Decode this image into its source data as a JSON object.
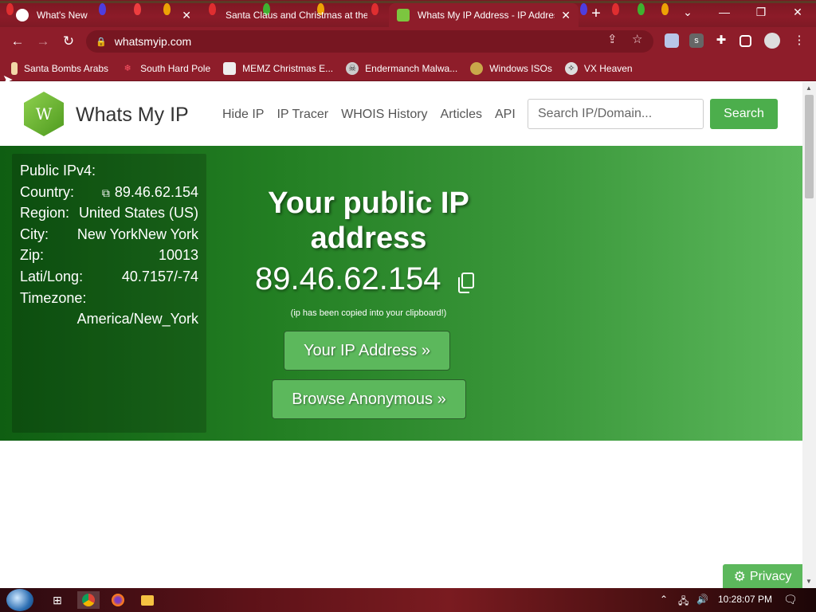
{
  "browser": {
    "tabs": [
      {
        "title": "What's New",
        "active": false
      },
      {
        "title": "Santa Claus and Christmas at the",
        "active": false
      },
      {
        "title": "Whats My IP Address - IP Addres",
        "active": true
      }
    ],
    "close_glyph": "✕",
    "new_tab_glyph": "+",
    "url": "whatsmyip.com",
    "bookmarks": [
      {
        "label": "Santa Bombs Arabs",
        "icon": "candle-icon"
      },
      {
        "label": "South Hard Pole",
        "icon": "snowflake-icon"
      },
      {
        "label": "MEMZ Christmas E...",
        "icon": "page-icon"
      },
      {
        "label": "Endermanch Malwa...",
        "icon": "skull-icon"
      },
      {
        "label": "Windows ISOs",
        "icon": "figure-icon"
      },
      {
        "label": "VX Heaven",
        "icon": "vx-icon"
      }
    ]
  },
  "site": {
    "logo_letter": "W",
    "brand": "Whats My IP",
    "nav": [
      "Hide IP",
      "IP Tracer",
      "WHOIS History",
      "Articles",
      "API"
    ],
    "search": {
      "placeholder": "Search IP/Domain...",
      "button": "Search"
    }
  },
  "info_panel": {
    "rows": [
      {
        "key": "Public IPv4:",
        "value": ""
      },
      {
        "key": "Country:",
        "value": "89.46.62.154"
      },
      {
        "key": "Region:",
        "value": "United States (US)"
      },
      {
        "key": "City:",
        "value": "New YorkNew York"
      },
      {
        "key": "Zip:",
        "value": "10013"
      },
      {
        "key": "Lati/Long:",
        "value": "40.7157/-74"
      },
      {
        "key": "Timezone:",
        "value": ""
      },
      {
        "key": "",
        "value": "America/New_York"
      }
    ]
  },
  "hero": {
    "title": "Your public IP address",
    "ip": "89.46.62.154",
    "copied_note": "(ip has been copied into your clipboard!)",
    "btn_ip": "Your IP Address »",
    "btn_anon": "Browse Anonymous »"
  },
  "privacy": {
    "label": "Privacy"
  },
  "taskbar": {
    "clock": "10:28:07 PM"
  }
}
